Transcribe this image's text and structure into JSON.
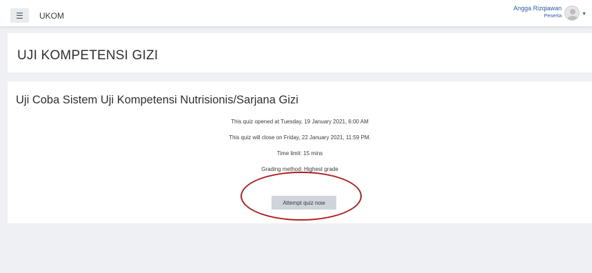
{
  "navbar": {
    "menu_icon": "hamburger-icon",
    "site_name": "UKOM",
    "user": {
      "name": "Angga Rizqiawan",
      "role": "Peserta",
      "avatar_icon": "user-avatar-icon",
      "dropdown_icon": "caret-down-icon"
    }
  },
  "header": {
    "title": "UJI KOMPETENSI GIZI"
  },
  "quiz": {
    "title": "Uji Coba Sistem Uji Kompetensi Nutrisionis/Sarjana Gizi",
    "opened": "This quiz opened at Tuesday, 19 January 2021, 6:00 AM",
    "closes": "This quiz will close on Friday, 22 January 2021, 11:59 PM.",
    "time_limit": "Time limit: 15 mins",
    "grading": "Grading method: Highest grade",
    "attempt_label": "Attempt quiz now"
  },
  "colors": {
    "accent_link": "#2a5db0",
    "highlight_circle": "#b01c1c",
    "button_bg": "#ced4da",
    "page_bg": "#eef0f3"
  }
}
